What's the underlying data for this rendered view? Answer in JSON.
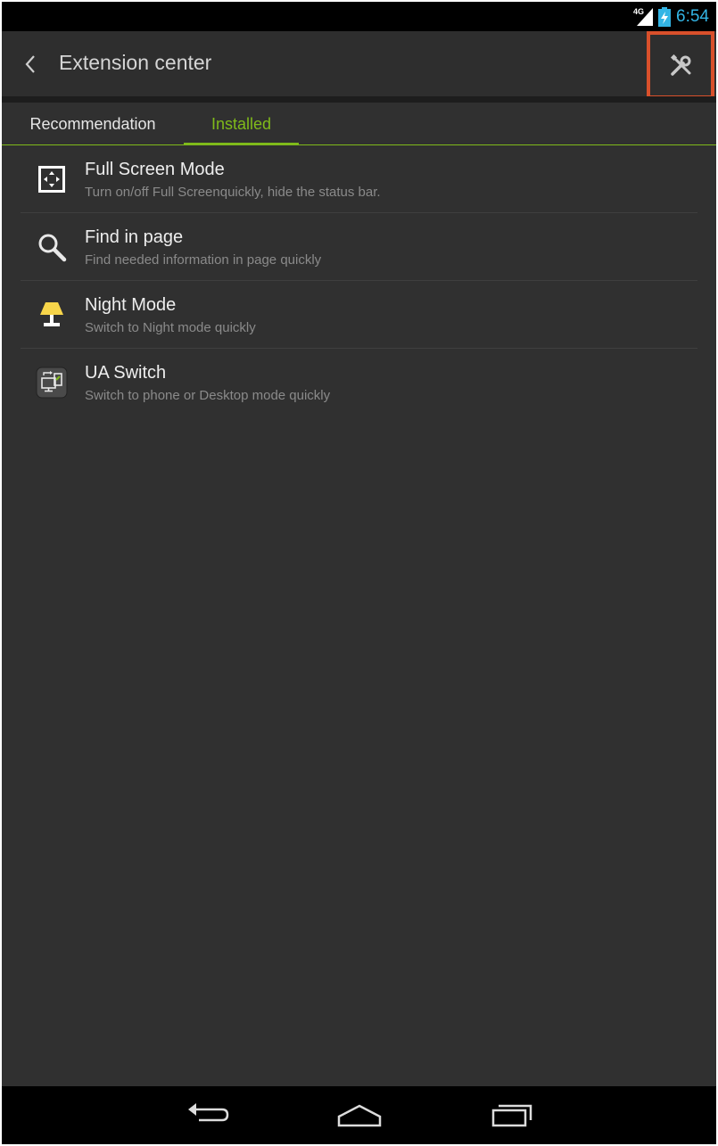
{
  "status_bar": {
    "network_label": "4G",
    "time": "6:54"
  },
  "action_bar": {
    "back_icon": "chevron-left-icon",
    "title": "Extension center",
    "settings_icon": "wrench-screwdriver-icon"
  },
  "tabs": [
    {
      "label": "Recommendation",
      "selected": false
    },
    {
      "label": "Installed",
      "selected": true
    }
  ],
  "accent_color": "#7fba1a",
  "highlight_color": "#d9502b",
  "extensions": [
    {
      "icon": "fullscreen-icon",
      "title": "Full Screen Mode",
      "description": "Turn on/off Full Screenquickly, hide the status bar."
    },
    {
      "icon": "search-icon",
      "title": "Find in page",
      "description": "Find needed information in page quickly"
    },
    {
      "icon": "lamp-icon",
      "title": "Night Mode",
      "description": "Switch to Night mode quickly"
    },
    {
      "icon": "ua-switch-icon",
      "title": "UA Switch",
      "description": "Switch to phone or Desktop mode quickly"
    }
  ],
  "nav_bar": {
    "back": "nav-back-icon",
    "home": "nav-home-icon",
    "recents": "nav-recents-icon"
  }
}
